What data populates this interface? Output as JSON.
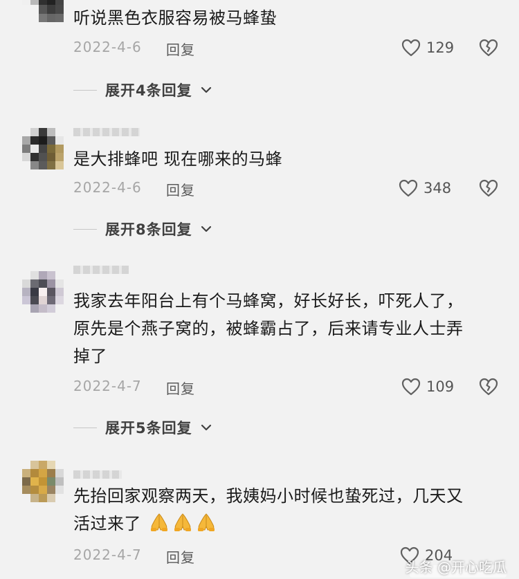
{
  "comments": [
    {
      "lines": [
        "听说黑色衣服容易被马蜂蛰"
      ],
      "date": "2022-4-6",
      "reply_label": "回复",
      "likes": "129",
      "expand_label": "展开4条回复"
    },
    {
      "lines": [
        "是大排蜂吧 现在哪来的马蜂"
      ],
      "date": "2022-4-6",
      "reply_label": "回复",
      "likes": "348",
      "expand_label": "展开8条回复"
    },
    {
      "lines": [
        "我家去年阳台上有个马蜂窝，好长好长，吓死人了，",
        "原先是个燕子窝的，被蜂霸占了，后来请专业人士弄",
        "掉了"
      ],
      "date": "2022-4-7",
      "reply_label": "回复",
      "likes": "109",
      "expand_label": "展开5条回复"
    },
    {
      "lines": [
        "先抬回家观察两天，我姨妈小时候也蛰死过，几天又",
        "活过来了"
      ],
      "emoji": [
        "pray-emoji",
        "pray-emoji",
        "pray-emoji"
      ],
      "date": "2022-4-7",
      "reply_label": "回复",
      "likes": "204"
    }
  ],
  "icons": {
    "like": "heart-outline-icon",
    "dislike": "broken-heart-icon",
    "expand": "chevron-down-icon"
  },
  "watermark": "头条 @开心吃瓜",
  "colors": {
    "background": "#f2f2f2",
    "text": "#1a1a1a",
    "meta": "#a6a6a6",
    "icon": "#606060"
  }
}
